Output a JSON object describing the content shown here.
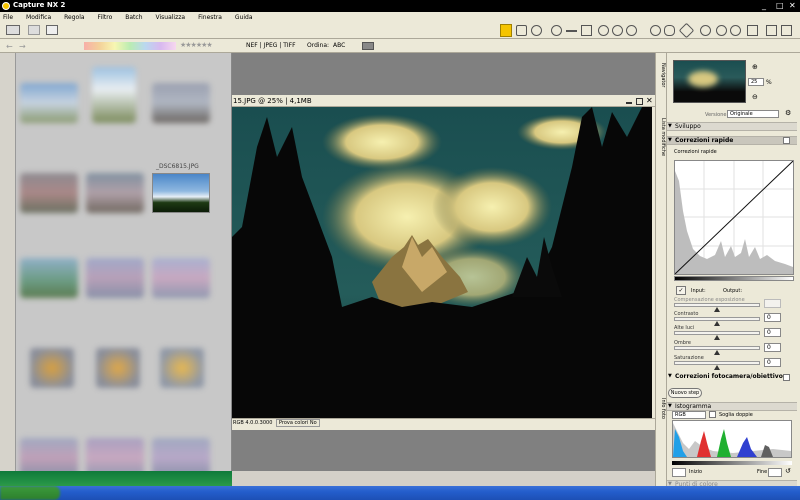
{
  "window": {
    "title": "Capture NX 2",
    "minimize": "_",
    "maximize": "□",
    "close": "✕"
  },
  "menu": [
    "File",
    "Modifica",
    "Regola",
    "Filtro",
    "Batch",
    "Visualizza",
    "Finestra",
    "Guida"
  ],
  "toolbar2": {
    "file_filter": "NEF | JPEG | TIFF",
    "sort_label": "Ordina:",
    "sort_value": "ABC"
  },
  "browser": {
    "selected_label": "_DSC6815.JPG"
  },
  "image_window": {
    "title": "15.JPG @ 25% | 4,1MB"
  },
  "statusbar": {
    "color_info": "RGB 4.0.0.3000",
    "proof_colors": "Prova colori No"
  },
  "right_tabs": [
    "Navigator",
    "Lista modifiche",
    "Info foto"
  ],
  "navigator": {
    "zoom_value": "25",
    "zoom_unit": "%"
  },
  "edit_list": {
    "version_label": "Versione",
    "version_value": "Originale",
    "section_develop": "Sviluppo",
    "section_quick_fix": "Correzioni rapide",
    "subsection_quick_fix": "Correzioni rapide",
    "input_label": "Input:",
    "output_label": "Output:",
    "sliders": [
      {
        "label": "Compensazione esposizione",
        "value": "",
        "pos": 0.5
      },
      {
        "label": "Contrasto",
        "value": "0",
        "pos": 0.5
      },
      {
        "label": "Alte luci",
        "value": "0",
        "pos": 0.5
      },
      {
        "label": "Ombre",
        "value": "0",
        "pos": 0.5
      },
      {
        "label": "Saturazione",
        "value": "0",
        "pos": 0.5
      }
    ],
    "section_camera": "Correzioni fotocamera/obiettivo",
    "new_step": "Nuovo step"
  },
  "histogram": {
    "title": "Istogramma",
    "channel": "RGB",
    "double_threshold": "Soglia doppie",
    "start_label": "Inizio",
    "end_label": "Fine",
    "next_section": "Punti di colore"
  },
  "colors": {
    "accent": "#f5c400",
    "panel": "#ece9d8",
    "sky": "#1f5c58"
  }
}
